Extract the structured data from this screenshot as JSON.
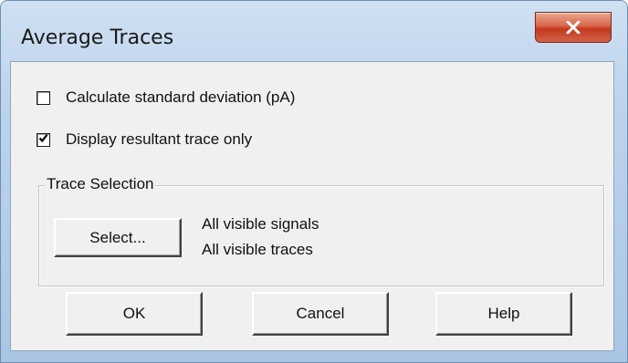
{
  "window": {
    "title": "Average Traces"
  },
  "options": {
    "calc_std_dev": {
      "label": "Calculate standard deviation (pA)",
      "checked": false
    },
    "display_resultant_only": {
      "label": "Display resultant trace only",
      "checked": true
    }
  },
  "trace_selection": {
    "group_title": "Trace Selection",
    "select_button": "Select...",
    "signals_text": "All visible signals",
    "traces_text": "All visible traces"
  },
  "buttons": {
    "ok": "OK",
    "cancel": "Cancel",
    "help": "Help"
  },
  "icons": {
    "close": "close-icon",
    "check": "checkmark-icon"
  },
  "colors": {
    "close_button": "#c1391c",
    "dialog_face": "#f0f0f0",
    "title_bar": "#bcd3ec"
  }
}
